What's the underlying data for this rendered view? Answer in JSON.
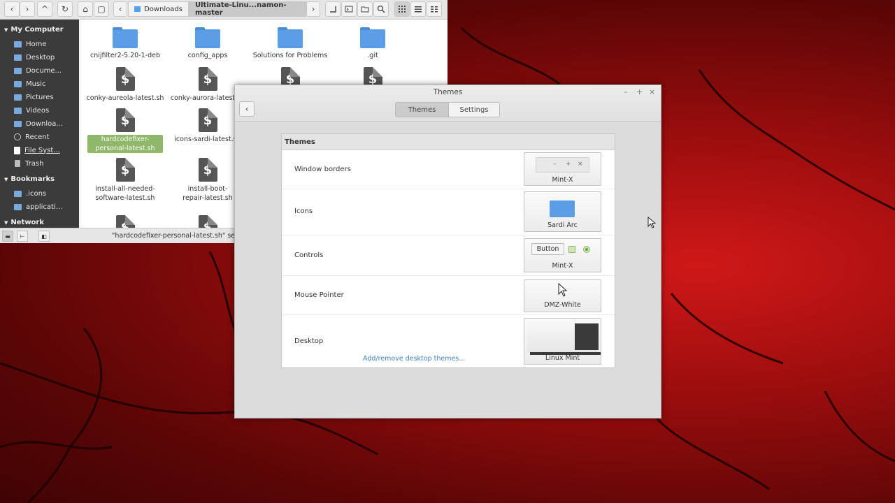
{
  "file_manager": {
    "toolbar": {
      "back_icon": "‹",
      "forward_icon": "›",
      "up_icon": "^",
      "reload_icon": "↻",
      "home_icon": "⌂",
      "computer_icon": "▢",
      "prev_icon": "‹",
      "next_icon": "›",
      "path": [
        "Downloads",
        "Ultimate-Linu...namon-master"
      ]
    },
    "sidebar": {
      "sections": [
        {
          "title": "My Computer",
          "items": [
            "Home",
            "Desktop",
            "Docume...",
            "Music",
            "Pictures",
            "Videos",
            "Downloa...",
            "Recent",
            "File Syst...",
            "Trash"
          ]
        },
        {
          "title": "Bookmarks",
          "items": [
            ".icons",
            "applicati..."
          ]
        },
        {
          "title": "Network",
          "items": []
        }
      ]
    },
    "files": [
      {
        "name": "cnijfilter2-5.20-1-deb",
        "type": "folder"
      },
      {
        "name": "config_apps",
        "type": "folder"
      },
      {
        "name": "Solutions for Problems",
        "type": "folder"
      },
      {
        "name": ".git",
        "type": "folder"
      },
      {
        "name": "conky-aureola-latest.sh",
        "type": "script"
      },
      {
        "name": "conky-aurora-latest.sh",
        "type": "script"
      },
      {
        "name": "",
        "type": "script"
      },
      {
        "name": "",
        "type": "script"
      },
      {
        "name": "hardcodefixer-personal-latest.sh",
        "type": "script",
        "selected": true
      },
      {
        "name": "icons-sardi-latest.sh",
        "type": "script"
      },
      {
        "name": "install-all-needed-software-latest.sh",
        "type": "script"
      },
      {
        "name": "install-boot-repair-latest.sh",
        "type": "script"
      }
    ],
    "status_text": "\"hardcodefixer-personal-latest.sh\" selected"
  },
  "themes_window": {
    "title": "Themes",
    "tabs": [
      "Themes",
      "Settings"
    ],
    "active_tab": "Themes",
    "window_controls": [
      "–",
      "+",
      "×"
    ],
    "panel_title": "Themes",
    "rows": [
      {
        "label": "Window borders",
        "value": "Mint-X"
      },
      {
        "label": "Icons",
        "value": "Sardi Arc"
      },
      {
        "label": "Controls",
        "value": "Mint-X"
      },
      {
        "label": "Mouse Pointer",
        "value": "DMZ-White"
      },
      {
        "label": "Desktop",
        "value": "Linux Mint"
      }
    ],
    "preview_controls": [
      "–",
      "+",
      "×"
    ],
    "control_preview_button": "Button",
    "add_remove_link": "Add/remove desktop themes..."
  },
  "colors": {
    "selection": "#8fb86a",
    "folder": "#5b9ee6",
    "link": "#3f7fc4",
    "sidebar": "#3b3b3b"
  }
}
